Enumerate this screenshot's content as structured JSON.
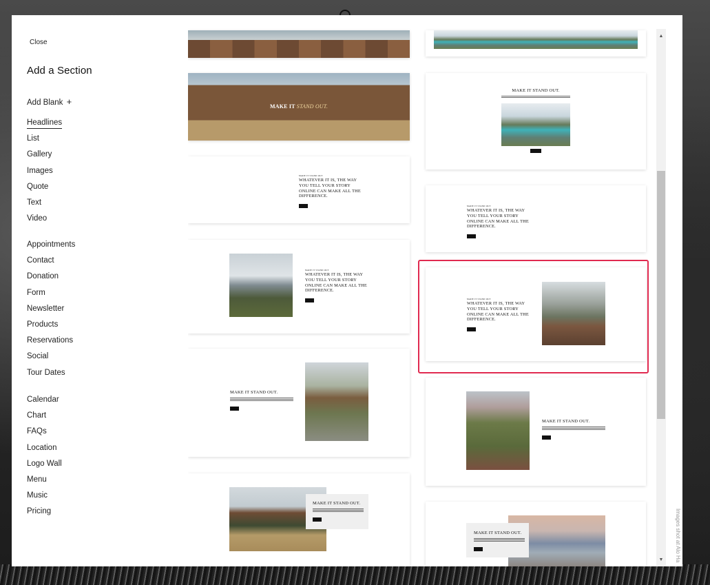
{
  "panel": {
    "close_label": "Close",
    "title": "Add a Section",
    "add_blank_label": "Add Blank",
    "add_blank_icon": "+"
  },
  "categories": {
    "group1": [
      "Headlines",
      "List",
      "Gallery",
      "Images",
      "Quote",
      "Text",
      "Video"
    ],
    "group2": [
      "Appointments",
      "Contact",
      "Donation",
      "Form",
      "Newsletter",
      "Products",
      "Reservations",
      "Social",
      "Tour Dates"
    ],
    "group3": [
      "Calendar",
      "Chart",
      "FAQs",
      "Location",
      "Logo Wall",
      "Menu",
      "Music",
      "Pricing"
    ],
    "active": "Headlines"
  },
  "thumbnails": {
    "hero_text_bold": "MAKE IT",
    "hero_text_italic": "STAND OUT.",
    "headline": "WHATEVER IT IS, THE WAY YOU TELL YOUR STORY ONLINE CAN MAKE ALL THE DIFFERENCE.",
    "eyebrow": "MADE IT STAND OUT",
    "title": "MAKE IT STAND OUT."
  },
  "selection": {
    "outline_color": "#e0294f"
  },
  "scrollbar": {
    "up_icon": "▲",
    "down_icon": "▼"
  },
  "credit": "Images shot at Alo Ha"
}
